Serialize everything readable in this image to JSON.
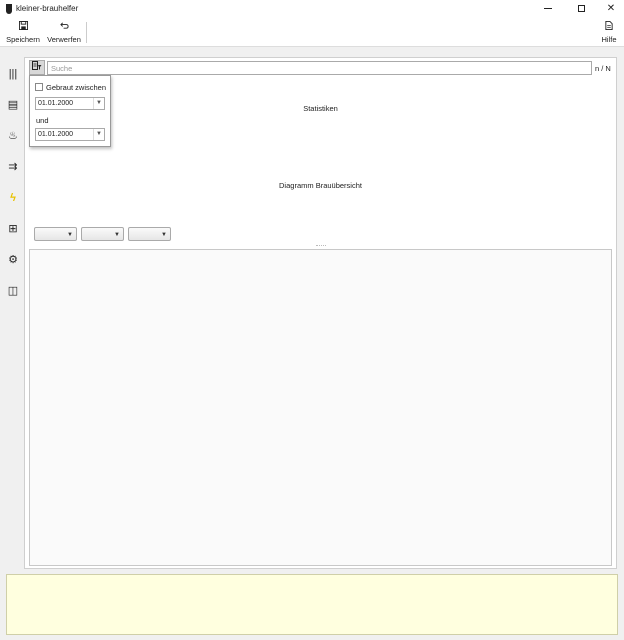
{
  "window": {
    "title": "kleiner-brauhelfer",
    "minimize_glyph": "—",
    "close_glyph": "✕"
  },
  "toolbar": {
    "save_label": "Speichern",
    "discard_label": "Verwerfen",
    "help_label": "Hilfe",
    "save_icon": "floppy-icon",
    "discard_icon": "undo-arrow-icon",
    "help_icon": "document-icon"
  },
  "sidebar": {
    "items": [
      {
        "icon": "list-icon",
        "glyph": "|||"
      },
      {
        "icon": "newspaper-icon",
        "glyph": "▤"
      },
      {
        "icon": "recipe-icon",
        "glyph": "♨"
      },
      {
        "icon": "flow-icon",
        "glyph": "⇉"
      },
      {
        "icon": "lightning-icon",
        "glyph": "ϟ"
      },
      {
        "icon": "add-brew-icon",
        "glyph": "⊞"
      },
      {
        "icon": "gear-icon",
        "glyph": "⚙"
      },
      {
        "icon": "dashboard-icon",
        "glyph": "◫"
      }
    ],
    "active_color": "#e8c200"
  },
  "search": {
    "placeholder": "Suche",
    "value": "",
    "count": "n / N",
    "filter_icon": "filter-icon"
  },
  "filter_popup": {
    "checkbox_label": "Gebraut zwischen",
    "checked": false,
    "date_from": "01.01.2000",
    "and_label": "und",
    "date_to": "01.01.2000"
  },
  "stats": {
    "title": "Statistiken"
  },
  "diagram": {
    "title": "Diagramm Brauübersicht",
    "selects": [
      "",
      "",
      ""
    ]
  },
  "colors": {
    "status_panel_bg": "#ffffdf",
    "frame_border": "#cfcfcf"
  }
}
